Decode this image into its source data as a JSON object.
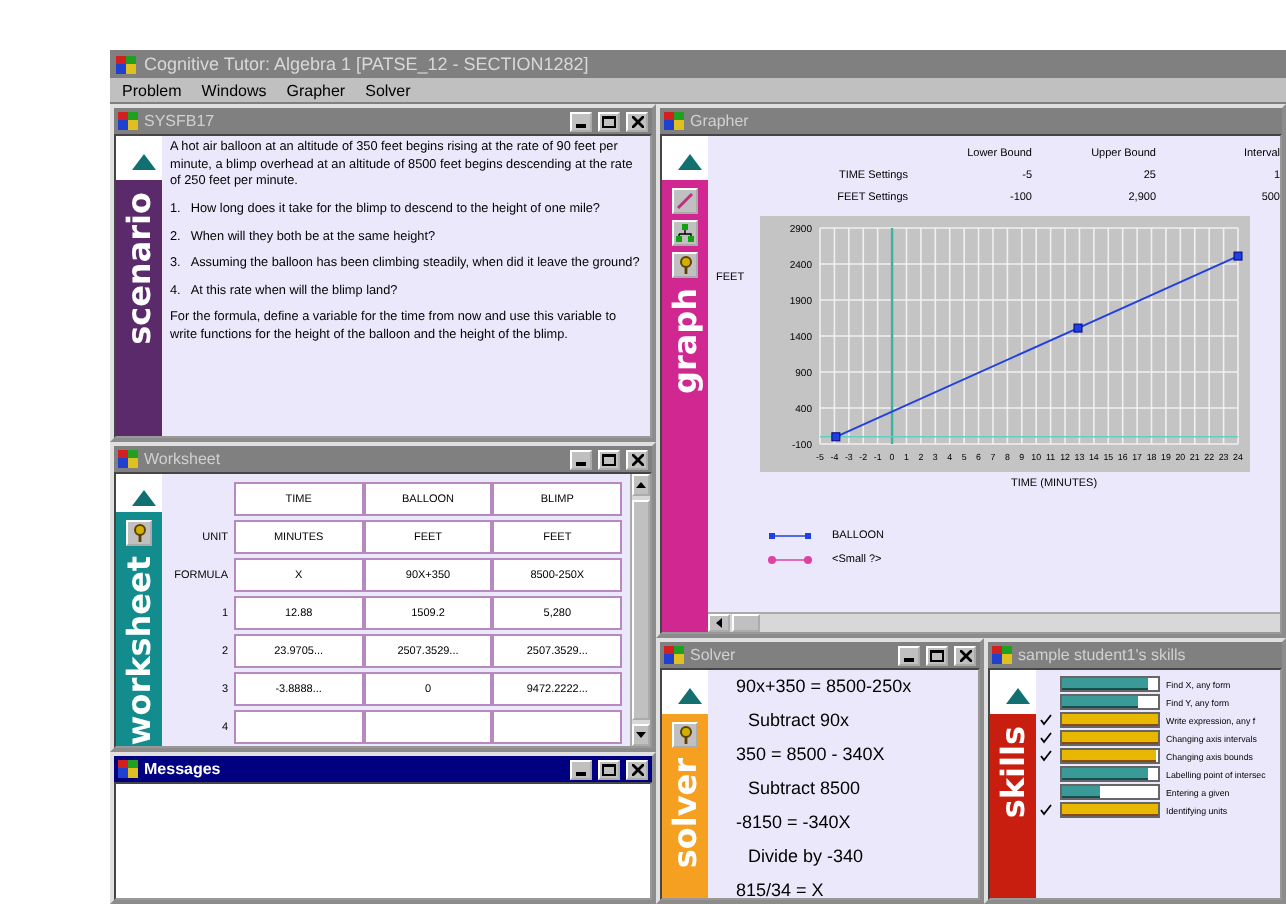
{
  "window": {
    "title": "Cognitive Tutor: Algebra 1  [PATSE_12 - SECTION1282]",
    "menu": [
      "Problem",
      "Windows",
      "Grapher",
      "Solver"
    ]
  },
  "scenario": {
    "title": "SYSFB17",
    "active": false,
    "controls": true,
    "band_label": "scenario",
    "intro": "A hot air balloon at an altitude of 350 feet begins rising at the rate of 90 feet per minute, a blimp overhead at an altitude of 8500 feet begins descending at the rate of 250 feet per minute.",
    "questions": [
      {
        "number": "1.",
        "text": "How long does it take for the blimp to descend to the height of one mile?"
      },
      {
        "number": "2.",
        "text": "When will they both be at the same height?"
      },
      {
        "number": "3.",
        "text": "Assuming the balloon has been climbing steadily, when did it leave the ground?"
      },
      {
        "number": "4.",
        "text": "At this rate when will the blimp land?"
      }
    ],
    "closing": "For the formula, define a variable for the time from now and use this variable to write functions for the height of the balloon and the height of the blimp."
  },
  "worksheet": {
    "title": "Worksheet",
    "active": false,
    "controls": true,
    "band_label": "worksheet",
    "tools": [
      {
        "kind": "hint"
      }
    ],
    "columns": [
      "TIME",
      "BALLOON",
      "BLIMP"
    ],
    "rows": [
      {
        "label": "UNIT",
        "cells": [
          "MINUTES",
          "FEET",
          "FEET"
        ]
      },
      {
        "label": "FORMULA",
        "cells": [
          "X",
          "90X+350",
          "8500-250X"
        ]
      },
      {
        "label": "1",
        "cells": [
          "12.88",
          "1509.2",
          "5,280"
        ]
      },
      {
        "label": "2",
        "cells": [
          "23.9705...",
          "2507.3529...",
          "2507.3529..."
        ]
      },
      {
        "label": "3",
        "cells": [
          "-3.8888...",
          "0",
          "9472.2222..."
        ]
      },
      {
        "label": "4",
        "cells": [
          "",
          "",
          ""
        ]
      }
    ]
  },
  "messages": {
    "title": "Messages",
    "active": true,
    "controls": true
  },
  "grapher": {
    "title": "Grapher",
    "active": false,
    "band_label": "graph",
    "tools": [
      {
        "kind": "line"
      },
      {
        "kind": "tree"
      },
      {
        "kind": "hint"
      }
    ],
    "settings_columns": [
      "Lower Bound",
      "Upper Bound",
      "Interval"
    ],
    "settings": [
      {
        "label": "TIME Settings",
        "values": [
          "-5",
          "25",
          "1"
        ]
      },
      {
        "label": "FEET Settings",
        "values": [
          "-100",
          "2,900",
          "500"
        ]
      }
    ],
    "chart_data": {
      "type": "line",
      "xlabel": "TIME (MINUTES)",
      "ylabel": "FEET",
      "grid": true,
      "x": [
        -3.9,
        12.9,
        24
      ],
      "series": [
        {
          "name": "BALLOON",
          "color": "#2040e0",
          "marker": "s",
          "values": [
            0,
            1510,
            2510
          ]
        },
        {
          "name": "<Small ?>",
          "color": "#e040a0",
          "marker": "o",
          "values": [
            null,
            null,
            null
          ]
        }
      ],
      "ref_lines": [
        {
          "axis": "x",
          "value": 0,
          "color": "#40b0a0"
        },
        {
          "axis": "y",
          "value": 0,
          "color": "#60d0c0"
        }
      ],
      "xlim": [
        -5,
        24
      ],
      "ylim": [
        -100,
        2900
      ],
      "xticks": [
        -5,
        -4,
        -3,
        -2,
        -1,
        0,
        1,
        2,
        3,
        4,
        5,
        6,
        7,
        8,
        9,
        10,
        11,
        12,
        13,
        14,
        15,
        16,
        17,
        18,
        19,
        20,
        21,
        22,
        23,
        24
      ],
      "yticks": [
        -100,
        400,
        900,
        1400,
        1900,
        2400,
        2900
      ]
    }
  },
  "solver": {
    "title": "Solver",
    "active": false,
    "controls": true,
    "band_label": "solver",
    "tools": [
      {
        "kind": "hint"
      }
    ],
    "steps": [
      {
        "kind": "equation",
        "text": "90x+350 = 8500-250x"
      },
      {
        "kind": "action",
        "text": "Subtract 90x"
      },
      {
        "kind": "equation",
        "text": "350 = 8500 - 340X"
      },
      {
        "kind": "action",
        "text": "Subtract 8500"
      },
      {
        "kind": "equation",
        "text": "-8150 = -340X"
      },
      {
        "kind": "action",
        "text": "Divide by -340"
      },
      {
        "kind": "equation",
        "text": "815/34 = X"
      }
    ]
  },
  "skills": {
    "title": "sample student1's skills",
    "active": false,
    "band_label": "skills",
    "items": [
      {
        "label": "Find X, any form",
        "level": 0.9,
        "mastered": false
      },
      {
        "label": "Find Y, any form",
        "level": 0.8,
        "mastered": false
      },
      {
        "label": "Write expression, any f",
        "level": 1,
        "mastered": true
      },
      {
        "label": "Changing axis intervals",
        "level": 1,
        "mastered": true
      },
      {
        "label": "Changing axis bounds",
        "level": 0.97,
        "mastered": true
      },
      {
        "label": "Labelling point of intersec",
        "level": 0.9,
        "mastered": false
      },
      {
        "label": "Entering a given",
        "level": 0.4,
        "mastered": false
      },
      {
        "label": "Identifying units",
        "level": 1,
        "mastered": true
      }
    ]
  }
}
